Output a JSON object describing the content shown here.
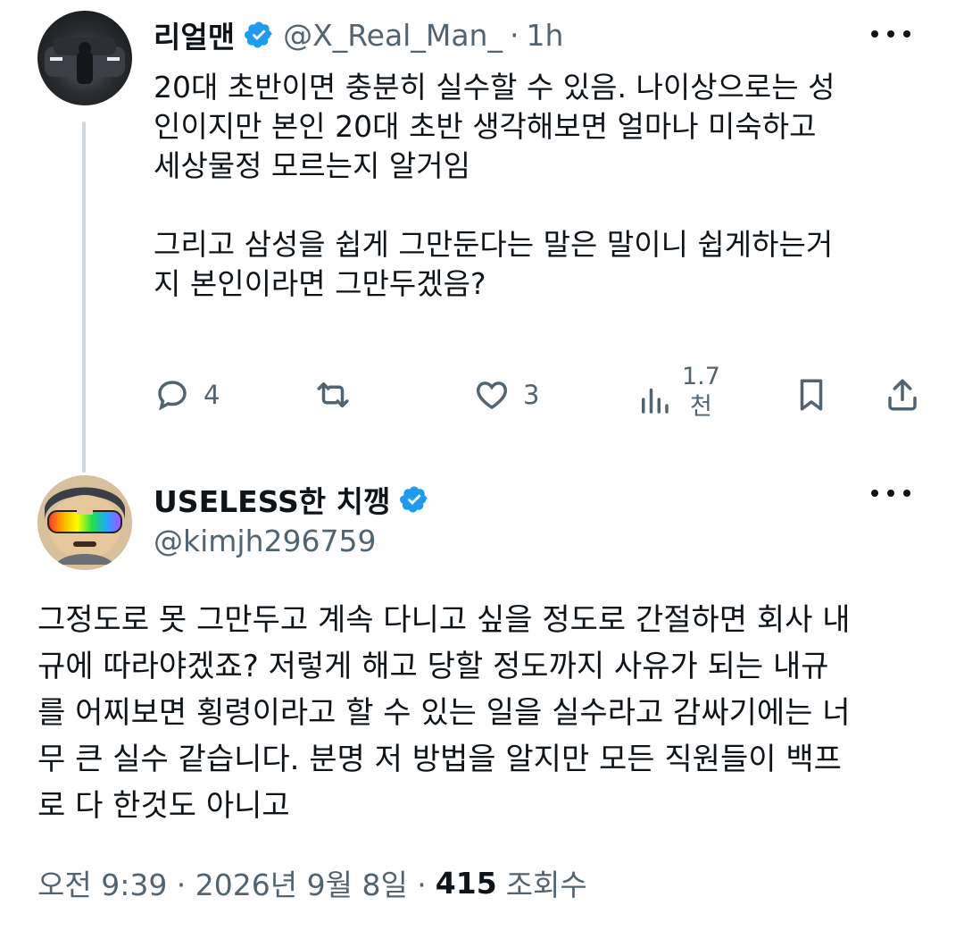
{
  "tweet1": {
    "name": "리얼맨",
    "handle": "@X_Real_Man_",
    "separator": "·",
    "time": "1h",
    "text": "20대 초반이면 충분히 실수할 수 있음. 나이상으로는 성\n인이지만 본인 20대 초반 생각해보면 얼마나 미숙하고\n세상물정 모르는지 알거임\n\n그리고 삼성을 쉽게 그만둔다는 말은 말이니 쉽게하는거\n지 본인이라면 그만두겠음?",
    "replies": "4",
    "likes": "3",
    "views_top": "1.7",
    "views_bottom": "천",
    "icons": [
      "reply-icon",
      "retweet-icon",
      "like-icon",
      "views-icon",
      "bookmark-icon",
      "share-icon"
    ]
  },
  "tweet2": {
    "name": "USELESS한 치깽",
    "handle": "@kimjh296759",
    "text": "그정도로 못 그만두고 계속 다니고 싶을 정도로 간절하면 회사 내\n규에 따라야겠죠? 저렇게 해고 당할 정도까지 사유가 되는 내규\n를 어찌보면 횡령이라고 할 수 있는 일을 실수라고 감싸기에는 너\n무 큰 실수 같습니다. 분명 저 방법을 알지만 모든 직원들이 백프\n로 다 한것도 아니고",
    "timestamp": "오전 9:39 · 2026년 9월 8일 ·",
    "views": "415",
    "views_label": "조회수"
  },
  "colors": {
    "verified": "#1d9bf0",
    "muted": "#536471",
    "text": "#0f1419",
    "thread_line": "#cfd9de"
  }
}
